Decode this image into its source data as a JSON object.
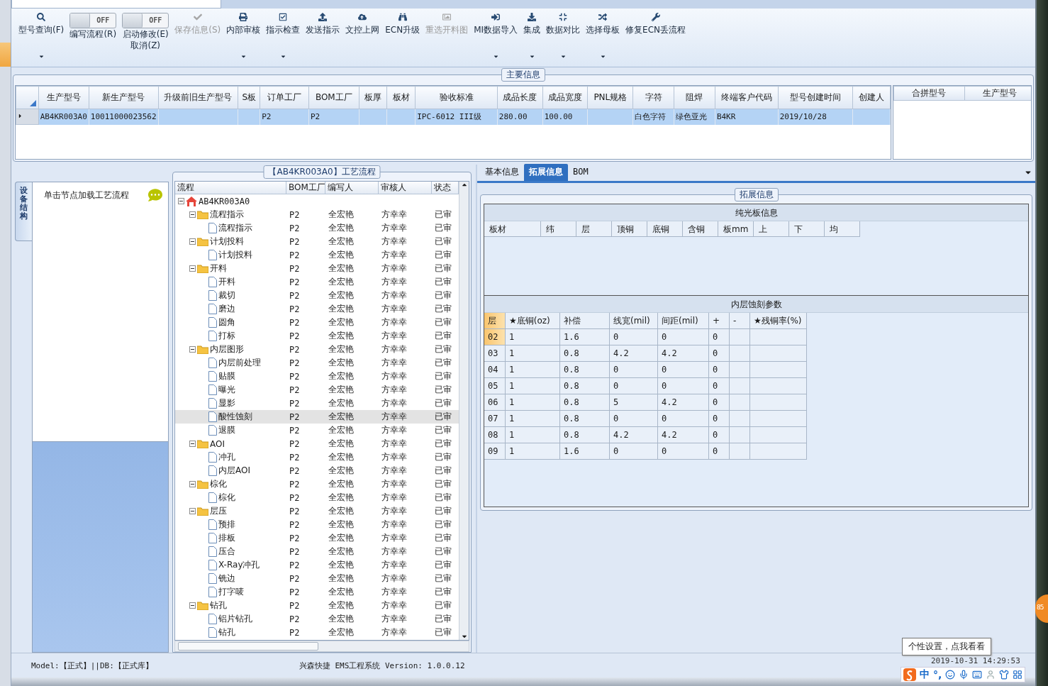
{
  "toolbar": [
    {
      "kind": "button",
      "label": [
        "型号查询(F)"
      ],
      "disabled": false,
      "dropdown": true
    },
    {
      "kind": "toggle",
      "label": [
        "编写流程(R)"
      ],
      "toggle_text": "OFF",
      "on": false
    },
    {
      "kind": "toggle",
      "label": [
        "启动修改(E)",
        "取消(Z)"
      ],
      "toggle_text": "OFF",
      "on": false
    },
    {
      "kind": "button",
      "label": [
        "保存信息(S)"
      ],
      "disabled": true,
      "dropdown": false
    },
    {
      "kind": "button",
      "label": [
        "内部审核"
      ],
      "disabled": false,
      "dropdown": true
    },
    {
      "kind": "button",
      "label": [
        "指示检查"
      ],
      "disabled": false,
      "dropdown": true
    },
    {
      "kind": "button",
      "label": [
        "发送指示"
      ],
      "disabled": false,
      "dropdown": false
    },
    {
      "kind": "button",
      "label": [
        "文控上网"
      ],
      "disabled": false,
      "dropdown": false
    },
    {
      "kind": "button",
      "label": [
        "ECN升级"
      ],
      "disabled": false,
      "dropdown": false
    },
    {
      "kind": "button",
      "label": [
        "重选开料图"
      ],
      "disabled": true,
      "dropdown": false
    },
    {
      "kind": "button",
      "label": [
        "MI数据导入"
      ],
      "disabled": false,
      "dropdown": true
    },
    {
      "kind": "button",
      "label": [
        "集成"
      ],
      "disabled": false,
      "dropdown": true
    },
    {
      "kind": "button",
      "label": [
        "数据对比"
      ],
      "disabled": false,
      "dropdown": true
    },
    {
      "kind": "button",
      "label": [
        "选择母板"
      ],
      "disabled": false,
      "dropdown": true
    },
    {
      "kind": "button",
      "label": [
        "修复ECN丢流程"
      ],
      "disabled": false,
      "dropdown": false
    }
  ],
  "main_info": {
    "title": "主要信息",
    "columns": [
      "生产型号",
      "新生产型号",
      "升级前旧生产型号",
      "S板",
      "订单工厂",
      "BOM工厂",
      "板厚",
      "板材",
      "验收标准",
      "成品长度",
      "成品宽度",
      "PNL规格",
      "字符",
      "阻焊",
      "终端客户代码",
      "型号创建时间",
      "创建人"
    ],
    "rows": [
      {
        "selected": true,
        "cells": [
          "AB4KR003A0",
          "10011000023562",
          "",
          "",
          "P2",
          "P2",
          "",
          "",
          "IPC-6012 III级",
          "280.00",
          "100.00",
          "",
          "白色字符",
          "绿色亚光",
          "B4KR",
          "2019/10/28",
          ""
        ]
      }
    ],
    "merge_columns": [
      "合拼型号",
      "生产型号"
    ]
  },
  "side_tab": "设备结构",
  "sidebar": {
    "hint": "单击节点加载工艺流程"
  },
  "process": {
    "title": "【AB4KR003A0】工艺流程",
    "columns": [
      "流程",
      "BOM工厂",
      "编写人",
      "审核人",
      "状态"
    ],
    "tree": [
      {
        "name": "AB4KR003A0",
        "kind": "root",
        "expanded": true,
        "selected": false,
        "children": [
          {
            "name": "流程指示",
            "kind": "folder",
            "expanded": true,
            "selected": false,
            "factory": "P2",
            "writer": "全宏艳",
            "reviewer": "方幸幸",
            "status": "已审",
            "children": [
              {
                "name": "流程指示",
                "kind": "step",
                "selected": false,
                "factory": "P2",
                "writer": "全宏艳",
                "reviewer": "方幸幸",
                "status": "已审"
              }
            ]
          },
          {
            "name": "计划投料",
            "kind": "folder",
            "expanded": true,
            "selected": false,
            "factory": "P2",
            "writer": "全宏艳",
            "reviewer": "方幸幸",
            "status": "已审",
            "children": [
              {
                "name": "计划投料",
                "kind": "step",
                "selected": false,
                "factory": "P2",
                "writer": "全宏艳",
                "reviewer": "方幸幸",
                "status": "已审"
              }
            ]
          },
          {
            "name": "开料",
            "kind": "folder",
            "expanded": true,
            "selected": false,
            "factory": "P2",
            "writer": "全宏艳",
            "reviewer": "方幸幸",
            "status": "已审",
            "children": [
              {
                "name": "开料",
                "kind": "step",
                "selected": false,
                "factory": "P2",
                "writer": "全宏艳",
                "reviewer": "方幸幸",
                "status": "已审"
              },
              {
                "name": "裁切",
                "kind": "step",
                "selected": false,
                "factory": "P2",
                "writer": "全宏艳",
                "reviewer": "方幸幸",
                "status": "已审"
              },
              {
                "name": "磨边",
                "kind": "step",
                "selected": false,
                "factory": "P2",
                "writer": "全宏艳",
                "reviewer": "方幸幸",
                "status": "已审"
              },
              {
                "name": "圆角",
                "kind": "step",
                "selected": false,
                "factory": "P2",
                "writer": "全宏艳",
                "reviewer": "方幸幸",
                "status": "已审"
              },
              {
                "name": "打标",
                "kind": "step",
                "selected": false,
                "factory": "P2",
                "writer": "全宏艳",
                "reviewer": "方幸幸",
                "status": "已审"
              }
            ]
          },
          {
            "name": "内层图形",
            "kind": "folder",
            "expanded": true,
            "selected": false,
            "factory": "P2",
            "writer": "全宏艳",
            "reviewer": "方幸幸",
            "status": "已审",
            "children": [
              {
                "name": "内层前处理",
                "kind": "step",
                "selected": false,
                "factory": "P2",
                "writer": "全宏艳",
                "reviewer": "方幸幸",
                "status": "已审"
              },
              {
                "name": "贴膜",
                "kind": "step",
                "selected": false,
                "factory": "P2",
                "writer": "全宏艳",
                "reviewer": "方幸幸",
                "status": "已审"
              },
              {
                "name": "曝光",
                "kind": "step",
                "selected": false,
                "factory": "P2",
                "writer": "全宏艳",
                "reviewer": "方幸幸",
                "status": "已审"
              },
              {
                "name": "显影",
                "kind": "step",
                "selected": false,
                "factory": "P2",
                "writer": "全宏艳",
                "reviewer": "方幸幸",
                "status": "已审"
              },
              {
                "name": "酸性蚀刻",
                "kind": "step",
                "selected": true,
                "factory": "P2",
                "writer": "全宏艳",
                "reviewer": "方幸幸",
                "status": "已审"
              },
              {
                "name": "退膜",
                "kind": "step",
                "selected": false,
                "factory": "P2",
                "writer": "全宏艳",
                "reviewer": "方幸幸",
                "status": "已审"
              }
            ]
          },
          {
            "name": "AOI",
            "kind": "folder",
            "expanded": true,
            "selected": false,
            "factory": "P2",
            "writer": "全宏艳",
            "reviewer": "方幸幸",
            "status": "已审",
            "children": [
              {
                "name": "冲孔",
                "kind": "step",
                "selected": false,
                "factory": "P2",
                "writer": "全宏艳",
                "reviewer": "方幸幸",
                "status": "已审"
              },
              {
                "name": "内层AOI",
                "kind": "step",
                "selected": false,
                "factory": "P2",
                "writer": "全宏艳",
                "reviewer": "方幸幸",
                "status": "已审"
              }
            ]
          },
          {
            "name": "棕化",
            "kind": "folder",
            "expanded": true,
            "selected": false,
            "factory": "P2",
            "writer": "全宏艳",
            "reviewer": "方幸幸",
            "status": "已审",
            "children": [
              {
                "name": "棕化",
                "kind": "step",
                "selected": false,
                "factory": "P2",
                "writer": "全宏艳",
                "reviewer": "方幸幸",
                "status": "已审"
              }
            ]
          },
          {
            "name": "层压",
            "kind": "folder",
            "expanded": true,
            "selected": false,
            "factory": "P2",
            "writer": "全宏艳",
            "reviewer": "方幸幸",
            "status": "已审",
            "children": [
              {
                "name": "预排",
                "kind": "step",
                "selected": false,
                "factory": "P2",
                "writer": "全宏艳",
                "reviewer": "方幸幸",
                "status": "已审"
              },
              {
                "name": "排板",
                "kind": "step",
                "selected": false,
                "factory": "P2",
                "writer": "全宏艳",
                "reviewer": "方幸幸",
                "status": "已审"
              },
              {
                "name": "压合",
                "kind": "step",
                "selected": false,
                "factory": "P2",
                "writer": "全宏艳",
                "reviewer": "方幸幸",
                "status": "已审"
              },
              {
                "name": "X-Ray冲孔",
                "kind": "step",
                "selected": false,
                "factory": "P2",
                "writer": "全宏艳",
                "reviewer": "方幸幸",
                "status": "已审"
              },
              {
                "name": "铣边",
                "kind": "step",
                "selected": false,
                "factory": "P2",
                "writer": "全宏艳",
                "reviewer": "方幸幸",
                "status": "已审"
              },
              {
                "name": "打字唛",
                "kind": "step",
                "selected": false,
                "factory": "P2",
                "writer": "全宏艳",
                "reviewer": "方幸幸",
                "status": "已审"
              }
            ]
          },
          {
            "name": "钻孔",
            "kind": "folder",
            "expanded": true,
            "selected": false,
            "factory": "P2",
            "writer": "全宏艳",
            "reviewer": "方幸幸",
            "status": "已审",
            "children": [
              {
                "name": "铝片钻孔",
                "kind": "step",
                "selected": false,
                "factory": "P2",
                "writer": "全宏艳",
                "reviewer": "方幸幸",
                "status": "已审"
              },
              {
                "name": "钻孔",
                "kind": "step",
                "selected": false,
                "factory": "P2",
                "writer": "全宏艳",
                "reviewer": "方幸幸",
                "status": "已审"
              }
            ]
          }
        ]
      }
    ]
  },
  "detail_tabs": [
    {
      "label": "基本信息",
      "selected": false
    },
    {
      "label": "拓展信息",
      "selected": true
    },
    {
      "label": "BOM",
      "selected": false
    }
  ],
  "extended": {
    "title": "拓展信息",
    "plain_board": {
      "title": "纯光板信息",
      "columns": [
        "板材",
        "纬",
        "层",
        "顶铜",
        "底铜",
        "含铜",
        "板mm",
        "上",
        "下",
        "均"
      ]
    },
    "etching": {
      "title": "内层蚀刻参数",
      "columns": [
        "层",
        "★底铜(oz)",
        "补偿",
        "线宽(mil)",
        "间距(mil)",
        "+",
        "-",
        "★残铜率(%)"
      ],
      "rows": [
        {
          "selected": true,
          "cells": [
            "02",
            "1",
            "1.6",
            "0",
            "0",
            "0"
          ]
        },
        {
          "selected": false,
          "cells": [
            "03",
            "1",
            "0.8",
            "4.2",
            "4.2",
            "0"
          ]
        },
        {
          "selected": false,
          "cells": [
            "04",
            "1",
            "0.8",
            "0",
            "0",
            "0"
          ]
        },
        {
          "selected": false,
          "cells": [
            "05",
            "1",
            "0.8",
            "0",
            "0",
            "0"
          ]
        },
        {
          "selected": false,
          "cells": [
            "06",
            "1",
            "0.8",
            "5",
            "4.2",
            "0"
          ]
        },
        {
          "selected": false,
          "cells": [
            "07",
            "1",
            "0.8",
            "0",
            "0",
            "0"
          ]
        },
        {
          "selected": false,
          "cells": [
            "08",
            "1",
            "0.8",
            "4.2",
            "4.2",
            "0"
          ]
        },
        {
          "selected": false,
          "cells": [
            "09",
            "1",
            "1.6",
            "0",
            "0",
            "0"
          ]
        }
      ]
    }
  },
  "status_bar": {
    "mode": "Model:【正式】||DB:【正式库】",
    "version": "兴森快捷 EMS工程系统 Version: 1.0.0.12",
    "clock": "2019-10-31 14:29:53"
  },
  "tooltip": "个性设置，点我看看",
  "ime": {
    "language": "中",
    "punctuation": "°,"
  },
  "badge": "85"
}
